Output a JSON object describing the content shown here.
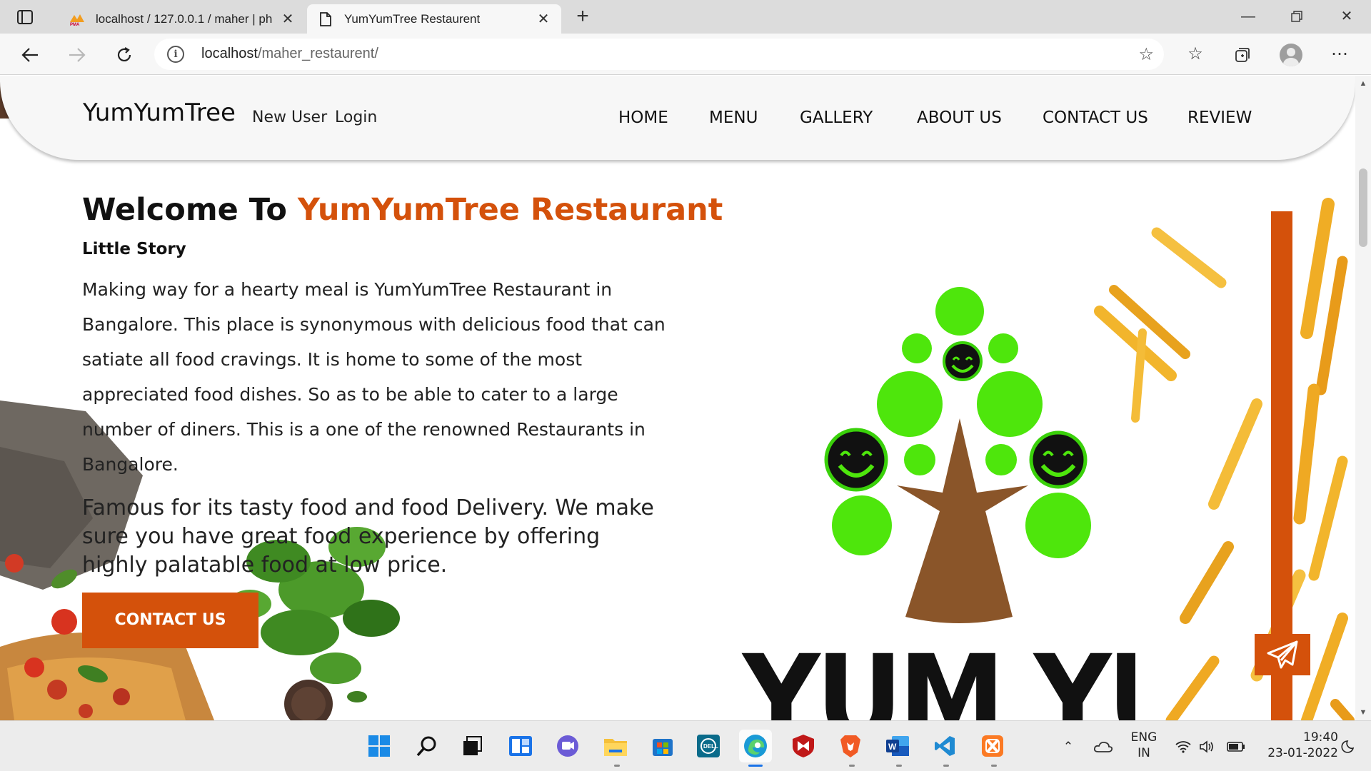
{
  "browser": {
    "tabs": [
      {
        "title": "localhost / 127.0.0.1 / maher | ph",
        "favicon": "phpmyadmin-icon"
      },
      {
        "title": "YumYumTree Restaurent",
        "favicon": "page-icon"
      }
    ],
    "url_host": "localhost",
    "url_path": "/maher_restaurent/"
  },
  "site": {
    "logo": "YumYumTree",
    "auth_links": {
      "new_user": "New User",
      "login": "Login"
    },
    "menu": [
      "HOME",
      "MENU",
      "GALLERY",
      "ABOUT US",
      "CONTACT US",
      "REVIEW"
    ],
    "hero": {
      "welcome_prefix": "Welcome To",
      "welcome_accent": "YumYumTree Restaurant",
      "subtitle": "Little Story",
      "paragraph1": "Making way for a hearty meal is YumYumTree Restaurant in Bangalore. This place is synonymous with delicious food that can satiate all food cravings. It is home to some of the most appreciated food dishes. So as to be able to cater to a large number of diners. This is a one of the renowned Restaurants in Bangalore.",
      "paragraph2": "Famous for its tasty food and food Delivery. We make sure you have great food experience by offering highly palatable food at low price.",
      "cta": "CONTACT US"
    },
    "brand_wordmark": "YUM YUM",
    "accent_color": "#d4510b"
  },
  "taskbar": {
    "language": {
      "line1": "ENG",
      "line2": "IN"
    },
    "time": "19:40",
    "date": "23-01-2022"
  }
}
